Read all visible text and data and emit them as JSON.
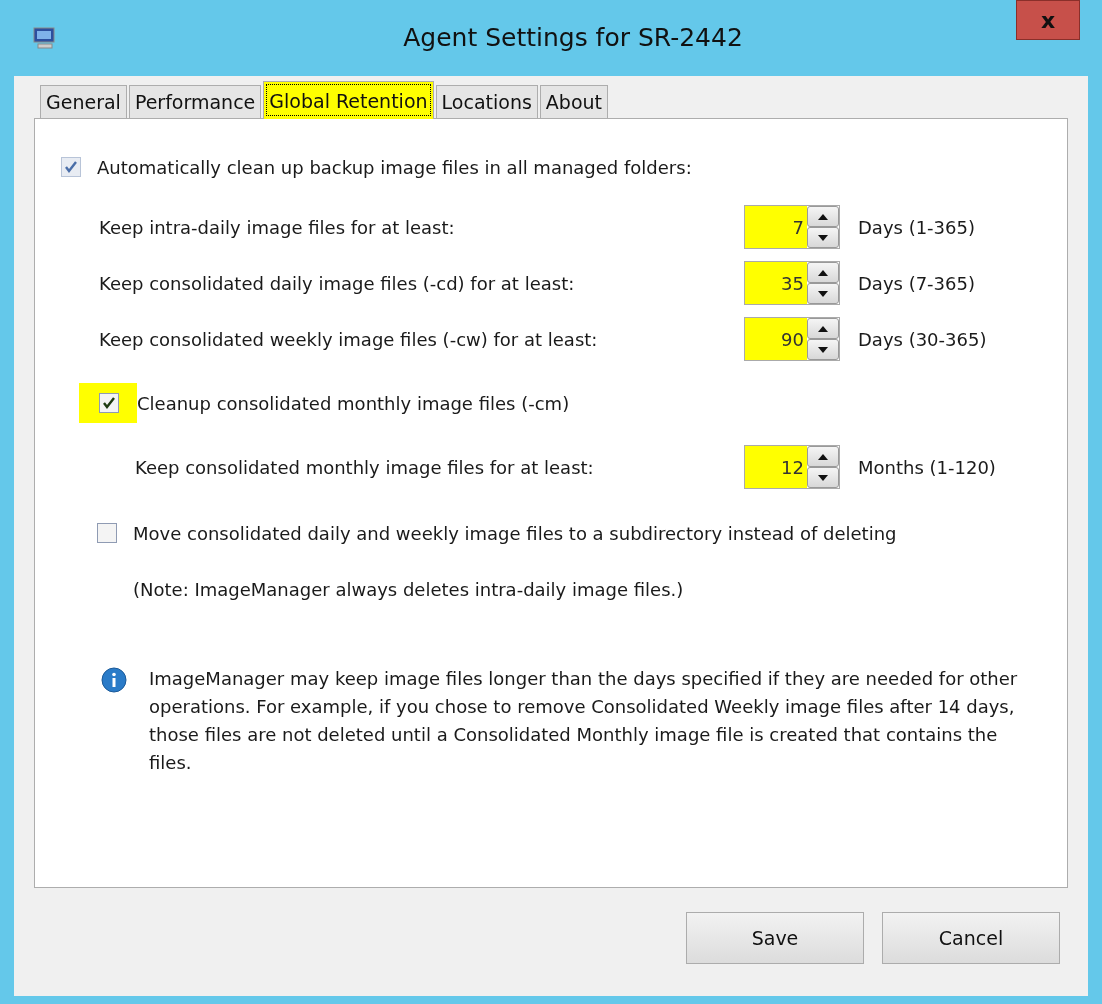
{
  "window": {
    "title": "Agent Settings for SR-2442",
    "close": "x"
  },
  "tabs": [
    {
      "label": "General",
      "selected": false,
      "highlighted": false
    },
    {
      "label": "Performance",
      "selected": false,
      "highlighted": false
    },
    {
      "label": "Global Retention",
      "selected": true,
      "highlighted": true
    },
    {
      "label": "Locations",
      "selected": false,
      "highlighted": false
    },
    {
      "label": "About",
      "selected": false,
      "highlighted": false
    }
  ],
  "auto_cleanup": {
    "label": "Automatically clean up backup image files in all managed folders:",
    "checked": true,
    "disabled": true
  },
  "retention": [
    {
      "label": "Keep intra-daily image files for at least:",
      "value": "7",
      "unit": "Days (1-365)",
      "highlighted": true
    },
    {
      "label": "Keep consolidated daily image files (-cd) for at least:",
      "value": "35",
      "unit": "Days (7-365)",
      "highlighted": true
    },
    {
      "label": "Keep consolidated weekly image files (-cw) for at least:",
      "value": "90",
      "unit": "Days (30-365)",
      "highlighted": true
    }
  ],
  "monthly": {
    "label": "Cleanup consolidated monthly image files (-cm)",
    "checked": true,
    "highlighted": true,
    "row": {
      "label": "Keep consolidated monthly image files for at least:",
      "value": "12",
      "unit": "Months (1-120)",
      "highlighted": true
    }
  },
  "move": {
    "label": "Move consolidated daily and weekly image files to a subdirectory instead of deleting",
    "checked": false
  },
  "note": "(Note:  ImageManager always deletes intra-daily image files.)",
  "info": "ImageManager may keep image files longer than the days specified if they are needed for other operations. For example, if you chose to remove Consolidated Weekly image files after 14 days, those files are not deleted until a Consolidated Monthly image file is created that contains the files.",
  "buttons": [
    "Save",
    "Cancel"
  ]
}
